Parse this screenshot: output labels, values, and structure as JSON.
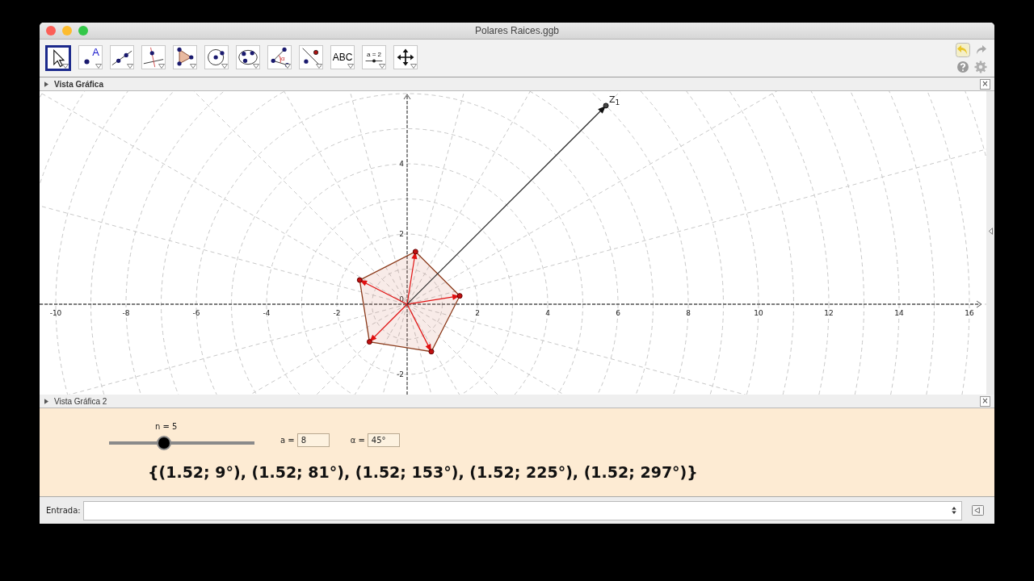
{
  "window": {
    "title": "Polares Raices.ggb"
  },
  "toolbar": {
    "tools": [
      {
        "kind": "move",
        "selected": true
      },
      {
        "kind": "point",
        "selected": false,
        "label": "A"
      },
      {
        "kind": "line",
        "selected": false
      },
      {
        "kind": "perpendicular",
        "selected": false
      },
      {
        "kind": "polygon",
        "selected": false
      },
      {
        "kind": "circle",
        "selected": false
      },
      {
        "kind": "conic",
        "selected": false
      },
      {
        "kind": "angle",
        "selected": false,
        "label": "α"
      },
      {
        "kind": "reflect",
        "selected": false
      },
      {
        "kind": "text",
        "selected": false,
        "label": "ABC"
      },
      {
        "kind": "slider",
        "selected": false,
        "label": "a = 2"
      },
      {
        "kind": "pan",
        "selected": false
      }
    ]
  },
  "graphics": {
    "title": "Vista Gráfica",
    "close": "×",
    "vector_label": "Z$_{1}$",
    "x_ticks": [
      "-10",
      "-8",
      "-6",
      "-4",
      "-2",
      "2",
      "4",
      "6",
      "8",
      "10",
      "12",
      "14",
      "16"
    ],
    "y_ticks": [
      "4",
      "2",
      "-2"
    ],
    "origin_label": "0"
  },
  "graphics2": {
    "title": "Vista Gráfica 2",
    "close": "×",
    "slider": {
      "label": "n = 5",
      "level": 0.38
    },
    "fields": [
      {
        "label": "a =",
        "value": "8"
      },
      {
        "label": "α =",
        "value": "45°"
      }
    ],
    "result": "{(1.52; 9°), (1.52; 81°), (1.52; 153°), (1.52; 225°), (1.52; 297°)}"
  },
  "input_bar": {
    "label": "Entrada:"
  }
}
